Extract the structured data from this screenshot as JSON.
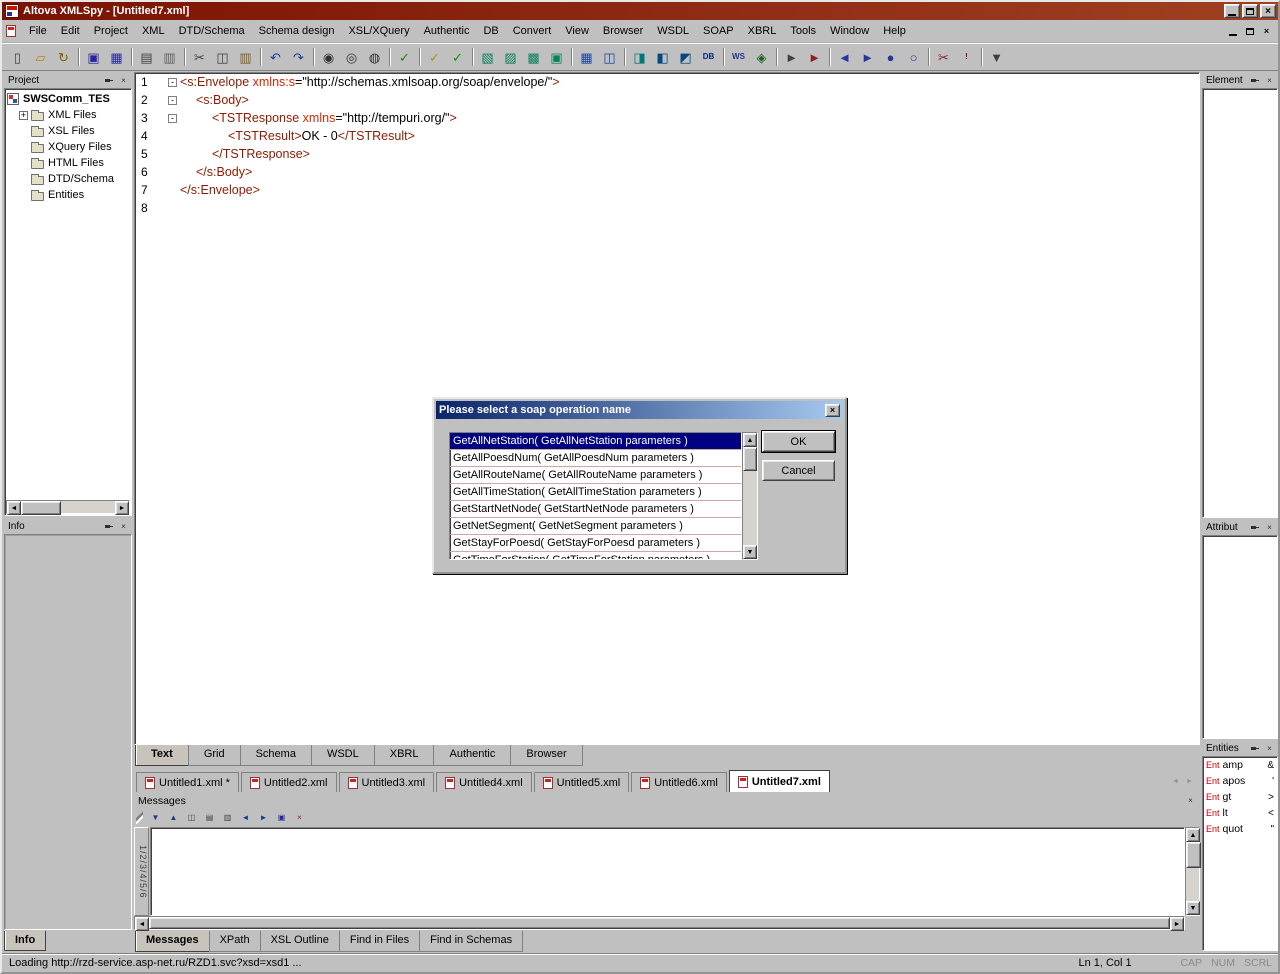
{
  "colors": {
    "titlebar": "#7a1202",
    "titlebar_light": "#a04022",
    "dialog_title_from": "#0a246a",
    "dialog_title_to": "#a6caf0",
    "selection": "#000080",
    "xml_tag": "#8b1c00",
    "xml_attr": "#d42800"
  },
  "window": {
    "title": "Altova XMLSpy - [Untitled7.xml]"
  },
  "menubar": {
    "items": [
      "File",
      "Edit",
      "Project",
      "XML",
      "DTD/Schema",
      "Schema design",
      "XSL/XQuery",
      "Authentic",
      "DB",
      "Convert",
      "View",
      "Browser",
      "WSDL",
      "SOAP",
      "XBRL",
      "Tools",
      "Window",
      "Help"
    ]
  },
  "toolbar": {
    "groups": [
      [
        {
          "n": "new-document",
          "g": "▯",
          "c": "#404040"
        },
        {
          "n": "open-file",
          "g": "▱",
          "c": "#b8860b"
        },
        {
          "n": "reload-file",
          "g": "↻",
          "c": "#806000"
        }
      ],
      [
        {
          "n": "save",
          "g": "▣",
          "c": "#24249c"
        },
        {
          "n": "save-all",
          "g": "▦",
          "c": "#24249c"
        }
      ],
      [
        {
          "n": "print",
          "g": "▤",
          "c": "#404040"
        },
        {
          "n": "print-preview",
          "g": "▥",
          "c": "#606060"
        }
      ],
      [
        {
          "n": "cut",
          "g": "✂",
          "c": "#404040"
        },
        {
          "n": "copy",
          "g": "◫",
          "c": "#404040"
        },
        {
          "n": "paste",
          "g": "▥",
          "c": "#806020"
        }
      ],
      [
        {
          "n": "undo",
          "g": "↶",
          "c": "#2038a0"
        },
        {
          "n": "redo",
          "g": "↷",
          "c": "#2038a0"
        }
      ],
      [
        {
          "n": "find",
          "g": "◉",
          "c": "#303030"
        },
        {
          "n": "find-next",
          "g": "◎",
          "c": "#303030"
        },
        {
          "n": "replace",
          "g": "◍",
          "c": "#303030"
        }
      ],
      [
        {
          "n": "spelling",
          "g": "✓",
          "c": "#208020"
        }
      ],
      [
        {
          "n": "check-wellformed",
          "g": "✓",
          "c": "#b09000"
        },
        {
          "n": "validate",
          "g": "✓",
          "c": "#109010"
        }
      ],
      [
        {
          "n": "insert-row",
          "g": "▧",
          "c": "#0a8060"
        },
        {
          "n": "append-row",
          "g": "▨",
          "c": "#0a8060"
        },
        {
          "n": "add-child",
          "g": "▩",
          "c": "#0a8060"
        },
        {
          "n": "delete-node",
          "g": "▣",
          "c": "#0a8060"
        }
      ],
      [
        {
          "n": "insert-table",
          "g": "▦",
          "c": "#1a44a0"
        },
        {
          "n": "display-db",
          "g": "◫",
          "c": "#1a44a0"
        }
      ],
      [
        {
          "n": "text-view",
          "g": "◨",
          "c": "#007878"
        },
        {
          "n": "grid-view",
          "g": "◧",
          "c": "#004880"
        },
        {
          "n": "schema-view",
          "g": "◩",
          "c": "#004880"
        },
        {
          "n": "db-view",
          "g": "DB",
          "c": "#002880",
          "t": 1
        }
      ],
      [
        {
          "n": "wsdl-view",
          "g": "WS",
          "c": "#203890",
          "t": 1
        },
        {
          "n": "soap-debugger",
          "g": "◈",
          "c": "#206020"
        }
      ],
      [
        {
          "n": "xsl-transform",
          "g": "►",
          "c": "#404040"
        },
        {
          "n": "xsl-fo-transform",
          "g": "►",
          "c": "#902020"
        }
      ],
      [
        {
          "n": "previous-bookmark",
          "g": "◄",
          "c": "#2038a0"
        },
        {
          "n": "next-bookmark",
          "g": "►",
          "c": "#2038a0"
        },
        {
          "n": "toggle-bookmark",
          "g": "●",
          "c": "#2038a0"
        },
        {
          "n": "clear-bookmarks",
          "g": "○",
          "c": "#2038a0"
        }
      ],
      [
        {
          "n": "cut-node",
          "g": "✂",
          "c": "#902020"
        },
        {
          "n": "sql-execute",
          "g": "!",
          "c": "#a00000",
          "t": 1
        }
      ],
      [
        {
          "n": "toolbar-options",
          "g": "▼",
          "c": "#404040"
        }
      ]
    ]
  },
  "project": {
    "title": "Project",
    "root": "SWSComm_TES",
    "items": [
      {
        "label": "XML Files",
        "expandable": true
      },
      {
        "label": "XSL Files",
        "expandable": false
      },
      {
        "label": "XQuery Files",
        "expandable": false
      },
      {
        "label": "HTML Files",
        "expandable": false
      },
      {
        "label": "DTD/Schema",
        "expandable": false
      },
      {
        "label": "Entities",
        "expandable": false
      }
    ]
  },
  "info": {
    "title": "Info",
    "tab": "Info"
  },
  "editor": {
    "lines": [
      {
        "num": "1",
        "fold": true,
        "indent": 0,
        "segs": [
          [
            "t",
            "<s:Envelope "
          ],
          [
            "a",
            "xmlns:s"
          ],
          [
            "o",
            "="
          ],
          [
            "v",
            "\"http://schemas.xmlsoap.org/soap/envelope/\""
          ],
          [
            "t",
            ">"
          ]
        ]
      },
      {
        "num": "2",
        "fold": true,
        "indent": 1,
        "segs": [
          [
            "t",
            "<s:Body>"
          ]
        ]
      },
      {
        "num": "3",
        "fold": true,
        "indent": 2,
        "segs": [
          [
            "t",
            "<TSTResponse "
          ],
          [
            "a",
            "xmlns"
          ],
          [
            "o",
            "="
          ],
          [
            "v",
            "\"http://tempuri.org/\""
          ],
          [
            "t",
            ">"
          ]
        ]
      },
      {
        "num": "4",
        "fold": false,
        "indent": 3,
        "segs": [
          [
            "t",
            "<TSTResult>"
          ],
          [
            "x",
            "OK - 0"
          ],
          [
            "t",
            "</TSTResult>"
          ]
        ]
      },
      {
        "num": "5",
        "fold": false,
        "indent": 2,
        "segs": [
          [
            "t",
            "</TSTResponse>"
          ]
        ]
      },
      {
        "num": "6",
        "fold": false,
        "indent": 1,
        "segs": [
          [
            "t",
            "</s:Body>"
          ]
        ]
      },
      {
        "num": "7",
        "fold": false,
        "indent": 0,
        "segs": [
          [
            "t",
            "</s:Envelope>"
          ]
        ]
      },
      {
        "num": "8",
        "fold": false,
        "indent": 0,
        "segs": []
      }
    ]
  },
  "view_tabs": {
    "items": [
      {
        "label": "Text",
        "active": true
      },
      {
        "label": "Grid",
        "active": false
      },
      {
        "label": "Schema",
        "active": false
      },
      {
        "label": "WSDL",
        "active": false
      },
      {
        "label": "XBRL",
        "active": false
      },
      {
        "label": "Authentic",
        "active": false
      },
      {
        "label": "Browser",
        "active": false
      }
    ]
  },
  "file_tabs": {
    "items": [
      {
        "label": "Untitled1.xml *",
        "active": false
      },
      {
        "label": "Untitled2.xml",
        "active": false
      },
      {
        "label": "Untitled3.xml",
        "active": false
      },
      {
        "label": "Untitled4.xml",
        "active": false
      },
      {
        "label": "Untitled5.xml",
        "active": false
      },
      {
        "label": "Untitled6.xml",
        "active": false
      },
      {
        "label": "Untitled7.xml",
        "active": true
      }
    ]
  },
  "messages": {
    "title": "Messages",
    "strip": "1/2/3/4/5/6",
    "icons": [
      {
        "n": "next-message",
        "g": "▼",
        "c": "#203890"
      },
      {
        "n": "previous-message",
        "g": "▲",
        "c": "#203890"
      },
      {
        "n": "copy-message",
        "g": "◫",
        "c": "#404040"
      },
      {
        "n": "copy-all-messages",
        "g": "▤",
        "c": "#404040"
      },
      {
        "n": "copy-filtered-messages",
        "g": "▥",
        "c": "#404040"
      },
      {
        "n": "goto-previous-result",
        "g": "◄",
        "c": "#203890"
      },
      {
        "n": "goto-next-result",
        "g": "►",
        "c": "#203890"
      },
      {
        "n": "save-messages",
        "g": "▣",
        "c": "#24249c"
      },
      {
        "n": "clear-messages",
        "g": "×",
        "c": "#902020"
      }
    ]
  },
  "bottom_tabs": {
    "items": [
      {
        "label": "Messages",
        "active": true
      },
      {
        "label": "XPath",
        "active": false
      },
      {
        "label": "XSL Outline",
        "active": false
      },
      {
        "label": "Find in Files",
        "active": false
      },
      {
        "label": "Find in Schemas",
        "active": false
      }
    ]
  },
  "panels": {
    "element": "Element",
    "attribut": "Attribut",
    "entities": "Entities"
  },
  "entities": {
    "rows": [
      {
        "prefix": "Ent",
        "name": "amp",
        "char": "&"
      },
      {
        "prefix": "Ent",
        "name": "apos",
        "char": "'"
      },
      {
        "prefix": "Ent",
        "name": "gt",
        "char": ">"
      },
      {
        "prefix": "Ent",
        "name": "lt",
        "char": "<"
      },
      {
        "prefix": "Ent",
        "name": "quot",
        "char": "\""
      }
    ]
  },
  "dialog": {
    "title": "Please select a soap operation name",
    "items": [
      "GetAllNetStation( GetAllNetStation parameters )",
      "GetAllPoesdNum( GetAllPoesdNum parameters )",
      "GetAllRouteName( GetAllRouteName parameters )",
      "GetAllTimeStation( GetAllTimeStation parameters )",
      "GetStartNetNode( GetStartNetNode parameters )",
      "GetNetSegment( GetNetSegment parameters )",
      "GetStayForPoesd( GetStayForPoesd parameters )",
      "GetTimeForStation( GetTimeForStation parameters )"
    ],
    "selected_index": 0,
    "ok": "OK",
    "cancel": "Cancel"
  },
  "status": {
    "text": "Loading http://rzd-service.asp-net.ru/RZD1.svc?xsd=xsd1 ...",
    "position": "Ln 1, Col 1",
    "cap": "CAP",
    "num": "NUM",
    "scrl": "SCRL"
  }
}
